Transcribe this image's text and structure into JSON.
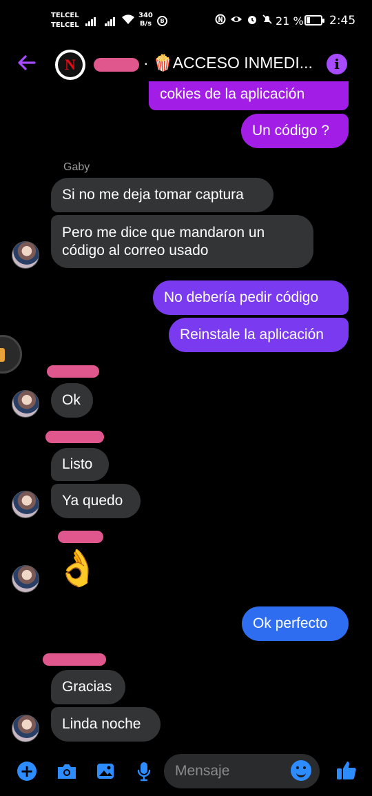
{
  "status_bar": {
    "carrier_1": "TELCEL",
    "carrier_2": "TELCEL",
    "net_speed_value": "340",
    "net_speed_unit": "B/s",
    "b_badge": "B",
    "battery_percent": "21 %",
    "time": "2:45"
  },
  "header": {
    "separator": "·",
    "title": "🍿ACCESO INMEDI...",
    "info_symbol": "i",
    "avatar_letter": "N",
    "accent": "#a64bff"
  },
  "colors": {
    "outgoing_top": "#a21ee6",
    "outgoing_mid": "#7a3bf0",
    "outgoing_bottom": "#2f6df0",
    "incoming": "#333436",
    "redaction": "#e0578e"
  },
  "messages": {
    "m1": "cokies de la aplicación",
    "m2": "Un código ?",
    "sender_gaby": "Gaby",
    "m3": "Si no me deja tomar captura",
    "m4_line1": "Pero me dice que mandaron un",
    "m4_line2": "código al correo usado",
    "m5": "No debería pedir código",
    "m6": "Reinstale la aplicación",
    "m7": "Ok",
    "m8": "Listo",
    "m9": "Ya quedo",
    "m10": "👌",
    "m11": "Ok perfecto",
    "m12": "Gracias",
    "m13": "Linda noche"
  },
  "composer": {
    "placeholder": "Mensaje",
    "add_symbol": "+"
  }
}
